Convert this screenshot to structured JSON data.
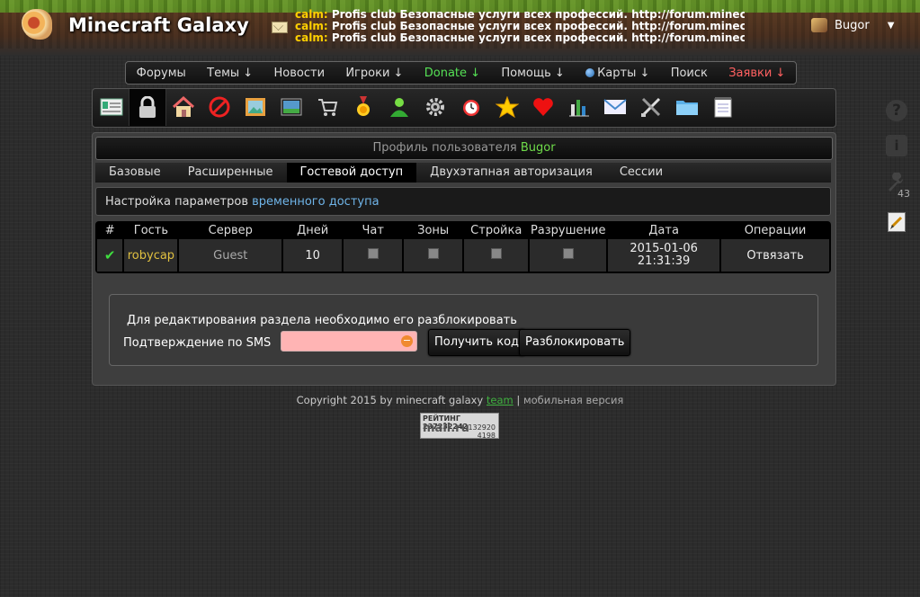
{
  "header": {
    "site_title": "Minecraft Galaxy",
    "news": [
      {
        "who": "calm:",
        "text": "Profis club Безопасные услуги всех профессий. http://forum.minecra..."
      },
      {
        "who": "calm:",
        "text": "Profis club Безопасные услуги всех профессий. http://forum.minecr..."
      },
      {
        "who": "calm:",
        "text": "Profis club Безопасные услуги всех профессий. http://forum.minec..."
      }
    ],
    "username": "Bugor",
    "user_menu_arrow": "▼"
  },
  "menu": {
    "items": [
      "Форумы",
      "Темы ↓",
      "Новости",
      "Игроки ↓",
      "Donate ↓",
      "Помощь ↓",
      "Карты ↓",
      "Поиск",
      "Заявки ↓"
    ]
  },
  "toolbar": {
    "icons": [
      "profile-card-icon",
      "lock-icon",
      "home-icon",
      "ban-icon",
      "picture-icon",
      "landscape-icon",
      "cart-icon",
      "medal-icon",
      "user-icon",
      "gear-icon",
      "alarm-clock-icon",
      "star-icon",
      "heart-icon",
      "bar-chart-icon",
      "envelope-icon",
      "tools-icon",
      "folder-icon",
      "notepad-icon"
    ]
  },
  "profile": {
    "title_prefix": "Профиль пользователя",
    "title_name": "Bugor"
  },
  "tabs": [
    "Базовые",
    "Расширенные",
    "Гостевой доступ",
    "Двухэтапная авторизация",
    "Сессии"
  ],
  "selected_tab": "Гостевой доступ",
  "settings": {
    "prefix": "Настройка параметров",
    "link": "временного доступа"
  },
  "access_table": {
    "headers": [
      "#",
      "Гость",
      "Сервер",
      "Дней",
      "Чат",
      "Зоны",
      "Стройка",
      "Разрушение",
      "Дата",
      "Операции"
    ],
    "rows": [
      {
        "status": "✔",
        "guest": "robycap",
        "server": "Guest",
        "days": "10",
        "chat": false,
        "zones": false,
        "build": false,
        "destroy": false,
        "date": "2015-01-06",
        "time": "21:31:39",
        "operation": "Отвязать"
      }
    ]
  },
  "unlock": {
    "note": "Для редактирования раздела необходимо его разблокировать",
    "sms_label": "Подтверждение по SMS",
    "sms_value": "",
    "error_glyph": "−",
    "get_code_button": "Получить код",
    "unlock_button": "Разблокировать"
  },
  "footer": {
    "copyright": "Copyright 2015 by minecraft galaxy",
    "team_link": "team",
    "separator": "|",
    "mobile_link": "мобильная версия"
  },
  "counter": {
    "label": "РЕЙТИНГ",
    "rating": "237232242",
    "brand": "mail.ru",
    "hits": "132920",
    "hosts": "4198"
  },
  "right_rail": {
    "help_glyph": "?",
    "info_glyph": "i",
    "tools_count": "43"
  }
}
